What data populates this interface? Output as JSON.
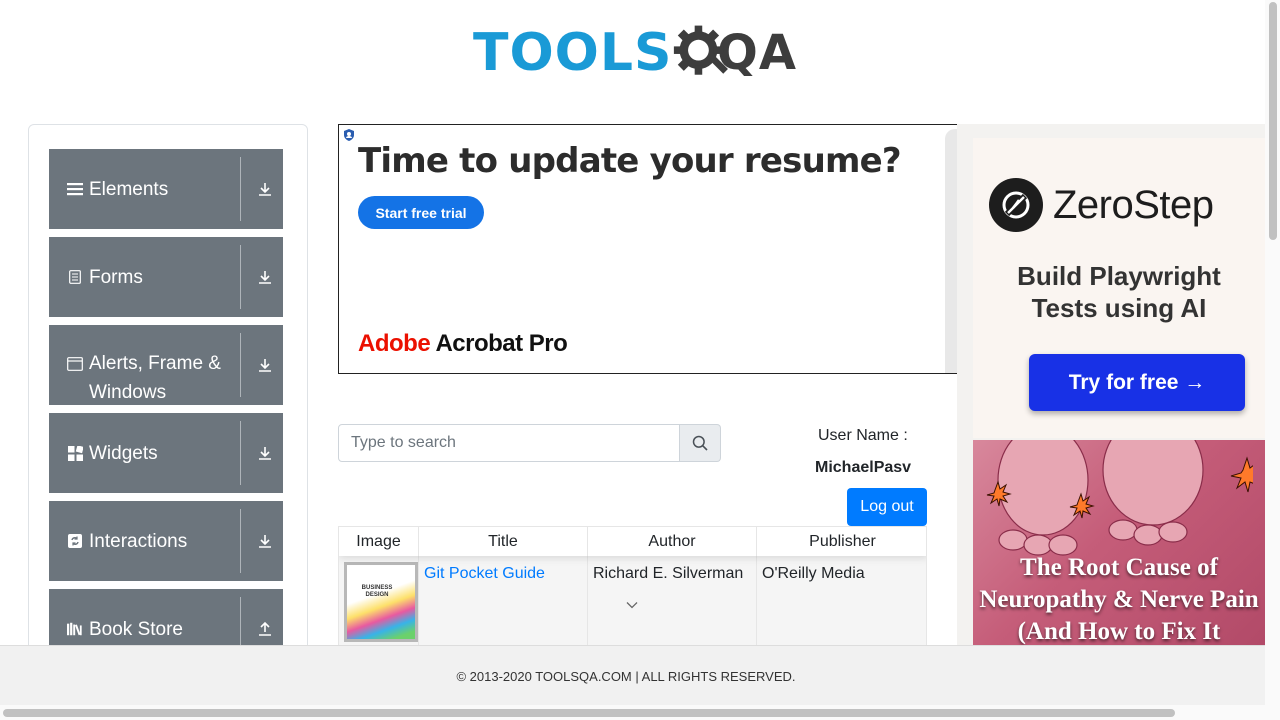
{
  "header": {
    "logo_part1": "TOOLS",
    "logo_part2": "QA"
  },
  "sidebar": {
    "groups": [
      {
        "label": "Elements",
        "icon": "hamburger-icon",
        "state": "collapsed"
      },
      {
        "label": "Forms",
        "icon": "document-icon",
        "state": "collapsed"
      },
      {
        "label": "Alerts, Frame & Windows",
        "icon": "window-icon",
        "state": "collapsed"
      },
      {
        "label": "Widgets",
        "icon": "widgets-icon",
        "state": "collapsed"
      },
      {
        "label": "Interactions",
        "icon": "refresh-icon",
        "state": "collapsed"
      },
      {
        "label": "Book Store",
        "icon": "books-icon",
        "state": "expanded"
      }
    ]
  },
  "ad_left": {
    "headline": "Time to update your resume?",
    "cta": "Start free trial",
    "brand_part1": "Adobe",
    "brand_part2": " Acrobat Pro"
  },
  "ad_right": {
    "brand": "ZeroStep",
    "subtitle": "Build Playwright Tests using AI",
    "cta": "Try for free →",
    "image_headline": "The Root Cause of Neuropathy & Nerve Pain (And How to Fix It"
  },
  "search": {
    "placeholder": "Type to search",
    "value": ""
  },
  "user": {
    "label": "User Name :",
    "value": "MichaelPasv",
    "logout_label": "Log out"
  },
  "table": {
    "columns": [
      "Image",
      "Title",
      "Author",
      "Publisher"
    ],
    "rows": [
      {
        "image": "BUSINESS DESIGN",
        "title": "Git Pocket Guide",
        "author": "Richard E. Silverman",
        "publisher": "O'Reilly Media"
      }
    ]
  },
  "footer": {
    "text": "© 2013-2020 TOOLSQA.COM | ALL RIGHTS RESERVED."
  },
  "colors": {
    "accent": "#007bff",
    "sidebar_group": "#6c757d",
    "logo_blue": "#1a9ad6",
    "logo_dark": "#3d3d3d"
  }
}
